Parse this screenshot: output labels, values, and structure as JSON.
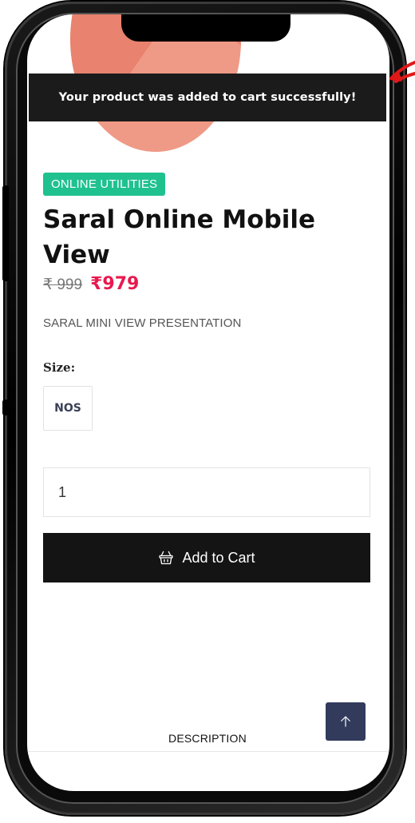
{
  "toast": {
    "message": "Your product was added to cart successfully!"
  },
  "product": {
    "category": "ONLINE UTILITIES",
    "title_line1": "Saral Online Mobile",
    "title_line2": "View",
    "price_old": "₹ 999",
    "price_new": "₹979",
    "subtitle": "SARAL MINI VIEW PRESENTATION"
  },
  "size": {
    "label": "Size:",
    "selected": "NOS"
  },
  "quantity": {
    "value": "1"
  },
  "cart": {
    "button_label": "Add to Cart",
    "icon": "basket-icon"
  },
  "tabs": {
    "description": "DESCRIPTION"
  },
  "scroll_top": {
    "icon": "arrow-up-icon"
  },
  "colors": {
    "toast_bg": "#1b1b1b",
    "badge": "#1fc18f",
    "price_new": "#e8194e",
    "button_bg": "#141414",
    "scroll_top_bg": "#323b5c",
    "annotation_arrow": "#e01818"
  }
}
